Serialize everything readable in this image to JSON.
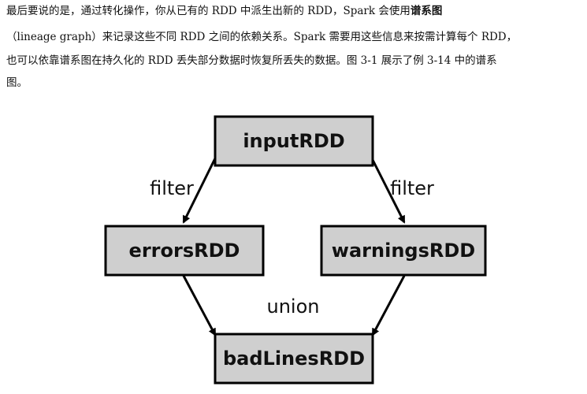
{
  "text": {
    "line1_prefix": "最后要说的是，通过转化操作，你从已有的 RDD 中派生出新的 RDD，Spark 会使用",
    "line1_bold": "谱系图",
    "line2": "（lineage graph）来记录这些不同 RDD 之间的依赖关系。Spark 需要用这些信息来按需计算每个 RDD，",
    "line3": "也可以依靠谱系图在持久化的 RDD 丢失部分数据时恢复所丢失的数据。图 3-1 展示了例 3-14 中的谱系",
    "line4": "图。"
  },
  "diagram": {
    "nodes": {
      "input": "inputRDD",
      "errors": "errorsRDD",
      "warnings": "warningsRDD",
      "badlines": "badLinesRDD"
    },
    "edges": {
      "filter_left": "filter",
      "filter_right": "filter",
      "union": "union"
    },
    "colors": {
      "node_fill": "#cfcfcf",
      "stroke": "#000000"
    }
  }
}
